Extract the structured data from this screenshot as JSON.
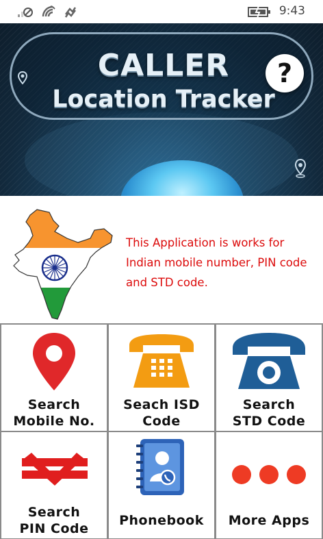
{
  "status_bar": {
    "time": "9:43",
    "icons": [
      "signal-off-icon",
      "wifi-icon",
      "data-sync-icon",
      "battery-charging-icon"
    ]
  },
  "banner": {
    "title_line1": "CALLER",
    "title_line2": "Location Tracker",
    "help_label": "?"
  },
  "info": {
    "text": "This Application is works for Indian mobile number, PIN code and STD code."
  },
  "tiles": [
    {
      "line1": "Search",
      "line2": "Mobile No.",
      "icon": "map-pin-icon"
    },
    {
      "line1": "Seach ISD",
      "line2": "Code",
      "icon": "telephone-icon"
    },
    {
      "line1": "Search",
      "line2": "STD Code",
      "icon": "rotary-phone-icon"
    },
    {
      "line1": "Search",
      "line2": "PIN Code",
      "icon": "india-post-icon"
    },
    {
      "line1": "Phonebook",
      "icon": "phonebook-icon"
    },
    {
      "line1": "More Apps",
      "icon": "more-dots-icon"
    }
  ],
  "colors": {
    "info_text": "#dc0a0a",
    "pin_red": "#e0282a",
    "phone_orange": "#f39c12",
    "phone_blue": "#1f5e97",
    "post_red": "#e01e1e",
    "dots_red": "#ee3b24"
  }
}
